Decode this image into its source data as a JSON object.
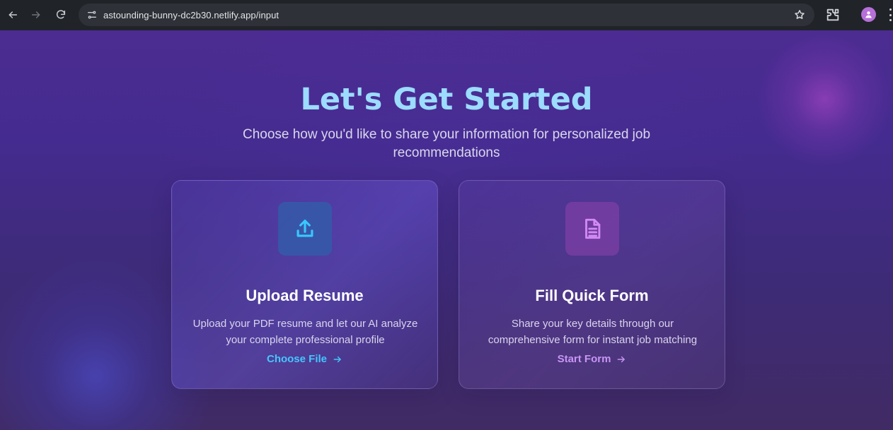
{
  "browser": {
    "url": "astounding-bunny-dc2b30.netlify.app/input"
  },
  "hero": {
    "title": "Let's Get Started",
    "subtitle": "Choose how you'd like to share your information for personalized job recommendations"
  },
  "cards": [
    {
      "title": "Upload Resume",
      "description": "Upload your PDF resume and let our AI analyze your complete professional profile",
      "action": "Choose File",
      "icon": "upload-icon",
      "accent": "#45c6ff"
    },
    {
      "title": "Fill Quick Form",
      "description": "Share your key details through our comprehensive form for instant job matching",
      "action": "Start Form",
      "icon": "document-icon",
      "accent": "#c795f4"
    }
  ],
  "colors": {
    "title": "#9cdcff",
    "background": "#442b8f"
  }
}
